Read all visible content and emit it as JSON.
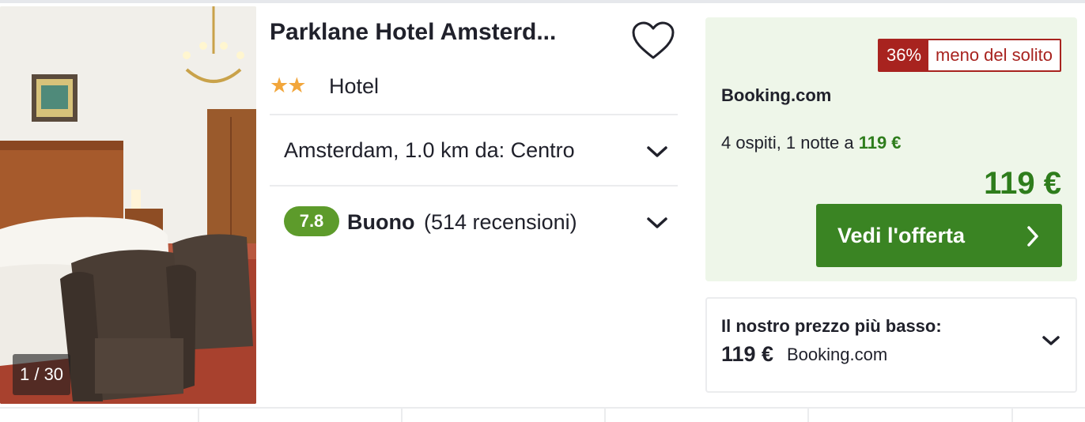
{
  "photo": {
    "counter": "1 / 30"
  },
  "hotel": {
    "name": "Parklane Hotel Amsterd...",
    "stars_glyph": "★★",
    "star_count": 2,
    "type": "Hotel",
    "location": "Amsterdam, 1.0 km da: Centro",
    "rating_score": "7.8",
    "rating_label": "Buono",
    "rating_reviews": "(514 recensioni)",
    "favorite_icon": "heart-outline-icon"
  },
  "deal": {
    "discount_percent": "36%",
    "discount_text": "meno del solito",
    "provider": "Booking.com",
    "stay_text": "4 ospiti, 1 notte a",
    "stay_price": "119 €",
    "price": "119 €",
    "cta_label": "Vedi l'offerta",
    "cta_icon": "chevron-right-icon"
  },
  "lowest_price": {
    "title": "Il nostro prezzo più basso:",
    "price": "119 €",
    "provider": "Booking.com"
  },
  "colors": {
    "accent_green": "#3a8423",
    "price_green": "#2e7d1c",
    "rating_green": "#5d9b2b",
    "discount_red": "#a8231f",
    "deal_background": "#eef6e9",
    "star_orange": "#f2a63b"
  }
}
